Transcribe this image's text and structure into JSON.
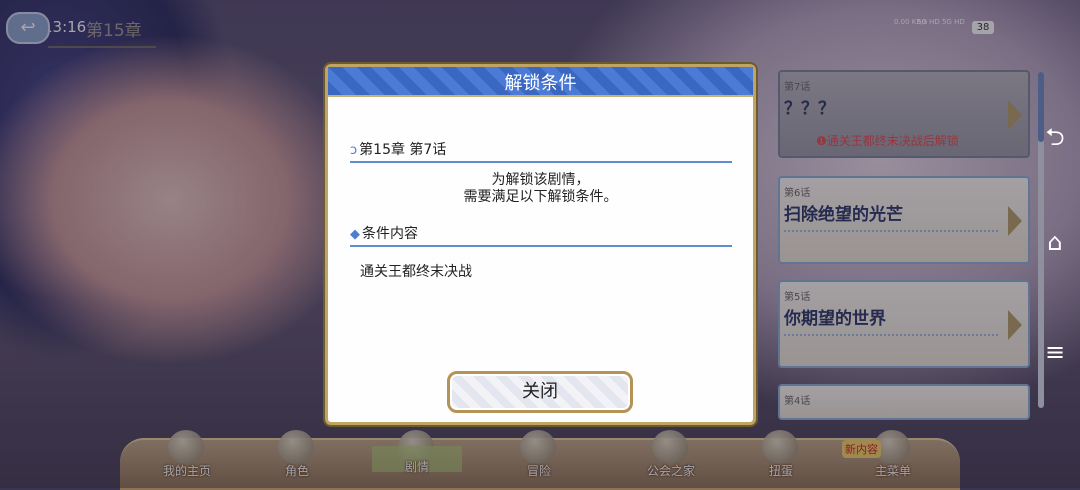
{
  "status_bar": {
    "time": "13:16",
    "net_speed": "0.00 KB/s",
    "signal": "5G HD 5G HD",
    "battery": "38"
  },
  "top_bar": {
    "chapter_label": "第15章"
  },
  "episodes": [
    {
      "num": "第7话",
      "title": "？？？",
      "lock_note": "❶通关王都终末决战后解锁",
      "locked": true
    },
    {
      "num": "第6话",
      "title": "扫除绝望的光芒",
      "locked": false
    },
    {
      "num": "第5话",
      "title": "你期望的世界",
      "locked": false
    },
    {
      "num": "第4话",
      "title": "",
      "locked": false
    }
  ],
  "bottom_menu": [
    {
      "label": "我的主页"
    },
    {
      "label": "角色"
    },
    {
      "label": "剧情"
    },
    {
      "label": "冒险"
    },
    {
      "label": "公会之家"
    },
    {
      "label": "扭蛋"
    },
    {
      "label": "主菜单"
    }
  ],
  "bottom_badge": "新内容",
  "modal": {
    "title": "解锁条件",
    "episode_heading": "第15章 第7话",
    "info_line1": "为解锁该剧情，",
    "info_line2": "需要满足以下解锁条件。",
    "condition_heading": "条件内容",
    "condition_text": "通关王都终末决战",
    "close_label": "关闭"
  },
  "colors": {
    "accent": "#3a67c2",
    "frame_gold": "#c0a463",
    "lock_red": "#e25050"
  }
}
